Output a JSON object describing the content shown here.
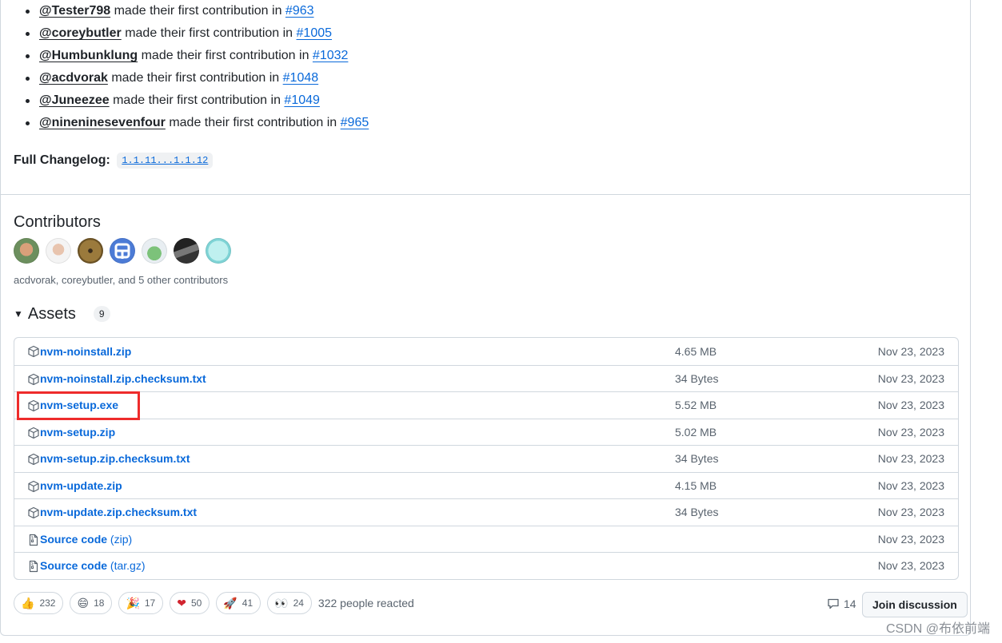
{
  "contributions": [
    {
      "user": "@Tester798",
      "text": "made their first contribution in",
      "pr": "#963"
    },
    {
      "user": "@coreybutler",
      "text": "made their first contribution in",
      "pr": "#1005"
    },
    {
      "user": "@Humbunklung",
      "text": "made their first contribution in",
      "pr": "#1032"
    },
    {
      "user": "@acdvorak",
      "text": "made their first contribution in",
      "pr": "#1048"
    },
    {
      "user": "@Juneezee",
      "text": "made their first contribution in",
      "pr": "#1049"
    },
    {
      "user": "@nineninesevenfour",
      "text": "made their first contribution in",
      "pr": "#965"
    }
  ],
  "changelog": {
    "label": "Full Changelog:",
    "range": "1.1.11...1.1.12"
  },
  "contributors": {
    "title": "Contributors",
    "summary": "acdvorak, coreybutler, and 5 other contributors",
    "avatars": [
      "avatar-1",
      "avatar-2",
      "avatar-3",
      "avatar-4",
      "avatar-5",
      "avatar-6",
      "avatar-7"
    ]
  },
  "assets": {
    "title": "Assets",
    "count": "9",
    "items": [
      {
        "name": "nvm-noinstall.zip",
        "suffix": "",
        "size": "4.65 MB",
        "date": "Nov 23, 2023",
        "icon": "package-icon"
      },
      {
        "name": "nvm-noinstall.zip.checksum.txt",
        "suffix": "",
        "size": "34 Bytes",
        "date": "Nov 23, 2023",
        "icon": "package-icon"
      },
      {
        "name": "nvm-setup.exe",
        "suffix": "",
        "size": "5.52 MB",
        "date": "Nov 23, 2023",
        "icon": "package-icon"
      },
      {
        "name": "nvm-setup.zip",
        "suffix": "",
        "size": "5.02 MB",
        "date": "Nov 23, 2023",
        "icon": "package-icon"
      },
      {
        "name": "nvm-setup.zip.checksum.txt",
        "suffix": "",
        "size": "34 Bytes",
        "date": "Nov 23, 2023",
        "icon": "package-icon"
      },
      {
        "name": "nvm-update.zip",
        "suffix": "",
        "size": "4.15 MB",
        "date": "Nov 23, 2023",
        "icon": "package-icon"
      },
      {
        "name": "nvm-update.zip.checksum.txt",
        "suffix": "",
        "size": "34 Bytes",
        "date": "Nov 23, 2023",
        "icon": "package-icon"
      },
      {
        "name": "Source code",
        "suffix": "(zip)",
        "size": "",
        "date": "Nov 23, 2023",
        "icon": "file-zip-icon"
      },
      {
        "name": "Source code",
        "suffix": "(tar.gz)",
        "size": "",
        "date": "Nov 23, 2023",
        "icon": "file-zip-icon"
      }
    ]
  },
  "reactions": {
    "items": [
      {
        "emoji": "👍",
        "icon": "thumbs-up-icon",
        "count": "232"
      },
      {
        "emoji": "😄",
        "icon": "laugh-icon",
        "count": "18"
      },
      {
        "emoji": "🎉",
        "icon": "hooray-icon",
        "count": "17"
      },
      {
        "emoji": "❤",
        "icon": "heart-icon",
        "count": "50"
      },
      {
        "emoji": "🚀",
        "icon": "rocket-icon",
        "count": "41"
      },
      {
        "emoji": "👀",
        "icon": "eyes-icon",
        "count": "24"
      }
    ],
    "summary": "322 people reacted"
  },
  "discussion": {
    "comments": "14",
    "join_label": "Join discussion"
  },
  "watermark": "CSDN @布依前端",
  "colors": {
    "link": "#0969da",
    "highlight": "#ee2b2b",
    "border": "#d0d7de",
    "muted": "#59636e"
  }
}
